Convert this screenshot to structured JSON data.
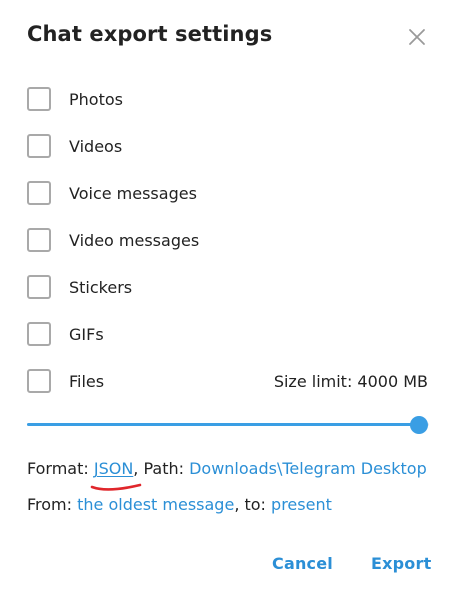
{
  "dialog": {
    "title": "Chat export settings",
    "close_icon": "close-icon"
  },
  "options": [
    {
      "label": "Photos",
      "checked": false
    },
    {
      "label": "Videos",
      "checked": false
    },
    {
      "label": "Voice messages",
      "checked": false
    },
    {
      "label": "Video messages",
      "checked": false
    },
    {
      "label": "Stickers",
      "checked": false
    },
    {
      "label": "GIFs",
      "checked": false
    },
    {
      "label": "Files",
      "checked": false
    }
  ],
  "size_limit": {
    "text": "Size limit: 4000 MB",
    "slider_fraction": 1.0
  },
  "format_line": {
    "format_label": "Format: ",
    "format_value": "JSON",
    "path_label": ", Path: ",
    "path_value": "Downloads\\Telegram Desktop"
  },
  "range_line": {
    "from_label": "From: ",
    "from_value": "the oldest message",
    "to_label": ", to: ",
    "to_value": "present"
  },
  "buttons": {
    "cancel": "Cancel",
    "export": "Export"
  },
  "colors": {
    "accent": "#3a9ee4",
    "link": "#2b8fd6",
    "annotation": "#e0262b"
  }
}
